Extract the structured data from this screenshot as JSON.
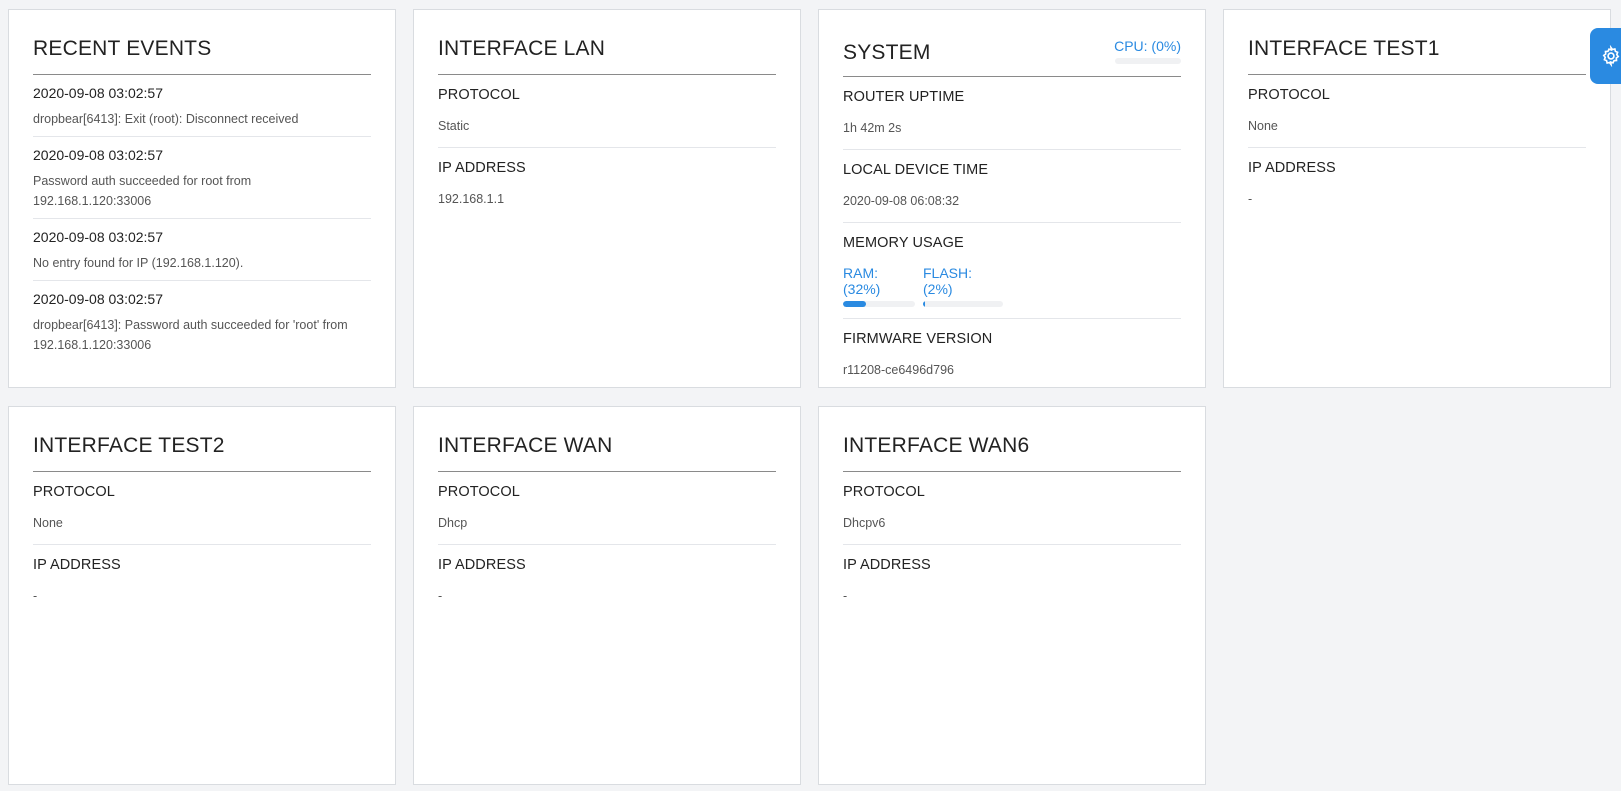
{
  "events_card": {
    "title": "RECENT EVENTS",
    "events": [
      {
        "time": "2020-09-08 03:02:57",
        "message": "dropbear[6413]: Exit (root): Disconnect received"
      },
      {
        "time": "2020-09-08 03:02:57",
        "message": "Password auth succeeded for root from 192.168.1.120:33006"
      },
      {
        "time": "2020-09-08 03:02:57",
        "message": "No entry found for IP (192.168.1.120)."
      },
      {
        "time": "2020-09-08 03:02:57",
        "message": "dropbear[6413]: Password auth succeeded for 'root' from 192.168.1.120:33006"
      }
    ]
  },
  "lan": {
    "title": "INTERFACE LAN",
    "protocol_label": "PROTOCOL",
    "protocol": "Static",
    "ip_label": "IP ADDRESS",
    "ip": "192.168.1.1"
  },
  "system": {
    "title": "SYSTEM",
    "cpu_label": "CPU: (0%)",
    "cpu_percent": 0,
    "uptime_label": "ROUTER UPTIME",
    "uptime": "1h 42m 2s",
    "time_label": "LOCAL DEVICE TIME",
    "time": "2020-09-08 06:08:32",
    "memory_label": "MEMORY USAGE",
    "ram_label": "RAM: (32%)",
    "ram_percent": 32,
    "flash_label": "FLASH: (2%)",
    "flash_percent": 2,
    "firmware_label": "FIRMWARE VERSION",
    "firmware": "r11208-ce6496d796"
  },
  "test1": {
    "title": "INTERFACE TEST1",
    "protocol_label": "PROTOCOL",
    "protocol": "None",
    "ip_label": "IP ADDRESS",
    "ip": "-"
  },
  "test2": {
    "title": "INTERFACE TEST2",
    "protocol_label": "PROTOCOL",
    "protocol": "None",
    "ip_label": "IP ADDRESS",
    "ip": "-"
  },
  "wan": {
    "title": "INTERFACE WAN",
    "protocol_label": "PROTOCOL",
    "protocol": "Dhcp",
    "ip_label": "IP ADDRESS",
    "ip": "-"
  },
  "wan6": {
    "title": "INTERFACE WAN6",
    "protocol_label": "PROTOCOL",
    "protocol": "Dhcpv6",
    "ip_label": "IP ADDRESS",
    "ip": "-"
  },
  "settings_button": {
    "icon": "gear-icon",
    "color": "#2a8ae1"
  },
  "colors": {
    "accent": "#2a8ae1"
  }
}
